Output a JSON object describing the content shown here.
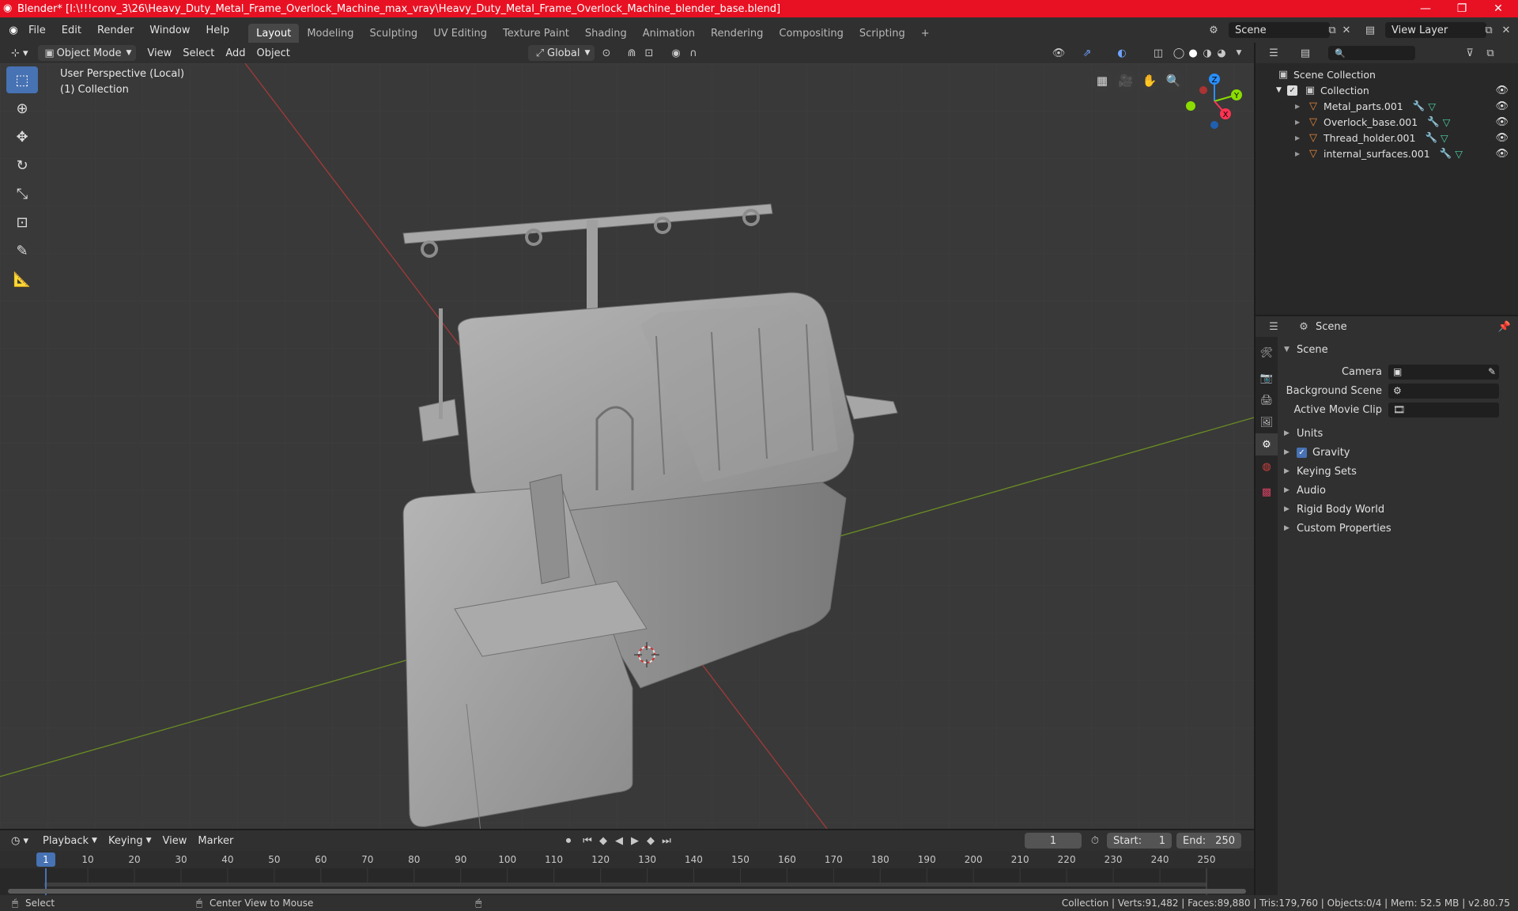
{
  "window": {
    "title": "Blender* [I:\\!!!conv_3\\26\\Heavy_Duty_Metal_Frame_Overlock_Machine_max_vray\\Heavy_Duty_Metal_Frame_Overlock_Machine_blender_base.blend]",
    "controls": [
      "—",
      "❐",
      "✕"
    ]
  },
  "menubar": {
    "menus": [
      "File",
      "Edit",
      "Render",
      "Window",
      "Help"
    ],
    "workspaces": [
      "Layout",
      "Modeling",
      "Sculpting",
      "UV Editing",
      "Texture Paint",
      "Shading",
      "Animation",
      "Rendering",
      "Compositing",
      "Scripting"
    ],
    "active_workspace": "Layout",
    "add_tab": "+",
    "scene": "Scene",
    "view_layer": "View Layer"
  },
  "viewport_header": {
    "mode": "Object Mode",
    "menus": [
      "View",
      "Select",
      "Add",
      "Object"
    ],
    "orientation": "Global"
  },
  "viewport": {
    "perspective": "User Perspective (Local)",
    "collection": "(1) Collection",
    "tools": [
      "select-box",
      "cursor",
      "move",
      "rotate",
      "scale",
      "transform",
      "annotate",
      "measure"
    ],
    "gizmo": {
      "x": "X",
      "y": "Y",
      "z": "Z"
    }
  },
  "outliner": {
    "search_placeholder": "",
    "root": "Scene Collection",
    "collection": "Collection",
    "objects": [
      "Metal_parts.001",
      "Overlock_base.001",
      "Thread_holder.001",
      "internal_surfaces.001"
    ]
  },
  "properties": {
    "breadcrumb": "Scene",
    "panel": "Scene",
    "fields": [
      {
        "label": "Camera",
        "value": ""
      },
      {
        "label": "Background Scene",
        "value": ""
      },
      {
        "label": "Active Movie Clip",
        "value": ""
      }
    ],
    "subpanels": [
      "Units",
      "Gravity",
      "Keying Sets",
      "Audio",
      "Rigid Body World",
      "Custom Properties"
    ],
    "gravity_enabled": true
  },
  "timeline": {
    "menus": [
      "Playback",
      "Keying",
      "View",
      "Marker"
    ],
    "current_frame": "1",
    "start_label": "Start:",
    "start": "1",
    "end_label": "End:",
    "end": "250",
    "ticks": [
      "1",
      "10",
      "20",
      "30",
      "40",
      "50",
      "60",
      "70",
      "80",
      "90",
      "100",
      "110",
      "120",
      "130",
      "140",
      "150",
      "160",
      "170",
      "180",
      "190",
      "200",
      "210",
      "220",
      "230",
      "240",
      "250"
    ]
  },
  "statusbar": {
    "left_action": "Select",
    "middle_action": "Center View to Mouse",
    "stats": "Collection | Verts:91,482 | Faces:89,880 | Tris:179,760 | Objects:0/4 | Mem: 52.5 MB | v2.80.75"
  },
  "colors": {
    "accent": "#4772b3",
    "titlebar": "#e81123",
    "object_icon": "#e8883a",
    "x_axis": "#ff3352",
    "y_axis": "#8bdc00",
    "z_axis": "#2890ff"
  }
}
